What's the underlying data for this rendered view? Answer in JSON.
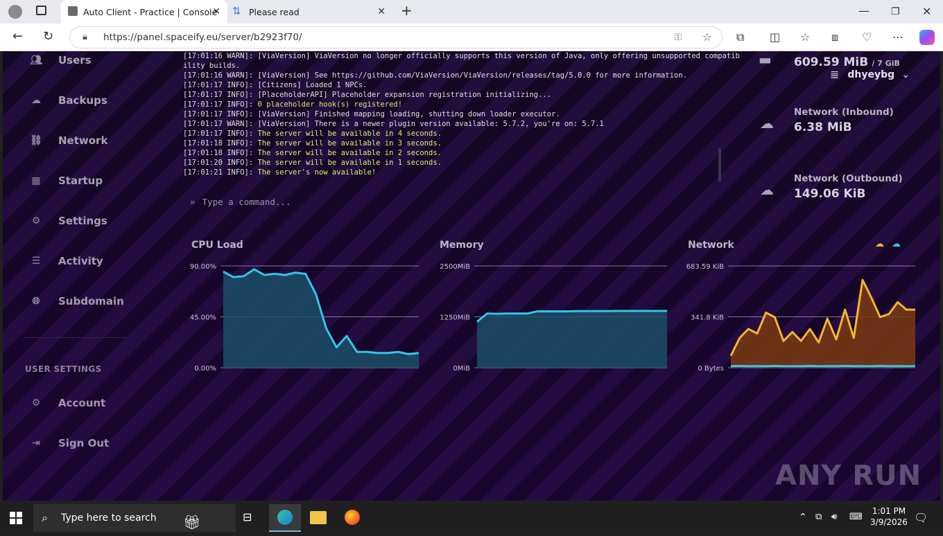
{
  "browser": {
    "tabs": [
      {
        "label": "Auto Client - Practice | Console"
      },
      {
        "label": "Please read"
      }
    ],
    "url": "https://panel.spaceify.eu/server/b2923f70/"
  },
  "sidebar": {
    "items": [
      {
        "label": "Users",
        "icon": "users-icon"
      },
      {
        "label": "Backups",
        "icon": "cloud-icon"
      },
      {
        "label": "Network",
        "icon": "network-icon"
      },
      {
        "label": "Startup",
        "icon": "chart-icon"
      },
      {
        "label": "Settings",
        "icon": "gear-icon"
      },
      {
        "label": "Activity",
        "icon": "list-icon"
      },
      {
        "label": "Subdomain",
        "icon": "globe-icon"
      }
    ],
    "section_title": "USER SETTINGS",
    "user_items": [
      {
        "label": "Account",
        "icon": "gear-icon"
      },
      {
        "label": "Sign Out",
        "icon": "signout-icon"
      }
    ]
  },
  "console": {
    "lines": [
      {
        "text": "[17:01:16 WARN]: [ViaVersion] ViaVersion no longer officially supports this version of Java, only offering unsupported compatib",
        "cls": "warn"
      },
      {
        "text": "ility builds.",
        "cls": "warn"
      },
      {
        "text": "[17:01:16 WARN]: [ViaVersion] See https://github.com/ViaVersion/ViaVersion/releases/tag/5.0.0 for more information.",
        "cls": "warn"
      },
      {
        "text": "[17:01:17 INFO]: [Citizens] Loaded 1 NPCs.",
        "cls": "warn"
      },
      {
        "text": "[17:01:17 INFO]: [PlaceholderAPI] Placeholder expansion registration initializing...",
        "cls": "warn"
      },
      {
        "text": "[17:01:17 INFO]: ",
        "extra": "0 placeholder hook(s) registered!",
        "cls": "ylw"
      },
      {
        "text": "[17:01:17 INFO]: [ViaVersion] Finished mapping loading, shutting down loader executor.",
        "cls": "warn"
      },
      {
        "text": "[17:01:17 WARN]: [ViaVersion] There is a newer plugin version available: 5.7.2, you're on: 5.7.1",
        "cls": "warn"
      },
      {
        "text": "[17:01:17 INFO]: ",
        "extra": "The server will be available in 4 seconds.",
        "cls": "grn"
      },
      {
        "text": "[17:01:18 INFO]: ",
        "extra": "The server will be available in 3 seconds.",
        "cls": "grn"
      },
      {
        "text": "[17:01:18 INFO]: ",
        "extra": "The server will be available in 2 seconds.",
        "cls": "grn"
      },
      {
        "text": "[17:01:20 INFO]: ",
        "extra": "The server will be available in 1 seconds.",
        "cls": "grn"
      },
      {
        "text": "[17:01:21 INFO]: ",
        "extra": "The server's now available!",
        "cls": "grn"
      }
    ],
    "command_placeholder": "Type a command..."
  },
  "header": {
    "username": "dhyeybg"
  },
  "stats": {
    "memory_value": "609.59 MiB",
    "memory_limit": "/ 7 GiB",
    "inbound_label": "Network (Inbound)",
    "inbound_value": "6.38 MiB",
    "outbound_label": "Network (Outbound)",
    "outbound_value": "149.06 KiB"
  },
  "chart_data": [
    {
      "type": "area",
      "title": "CPU Load",
      "ytick_labels": [
        "90.00%",
        "45.00%",
        "0.00%"
      ],
      "ylim": [
        0,
        90
      ],
      "series": [
        {
          "values": [
            85,
            80,
            81,
            87,
            82,
            83,
            82,
            84,
            83,
            65,
            35,
            18,
            28,
            14,
            14,
            13,
            13,
            14,
            12,
            13
          ]
        }
      ],
      "colors": {
        "line": "#33c6e8",
        "fill": "#1b4f66"
      }
    },
    {
      "type": "area",
      "title": "Memory",
      "ytick_labels": [
        "2500MiB",
        "1250MiB",
        "0MiB"
      ],
      "ylim": [
        0,
        2500
      ],
      "series": [
        {
          "values": [
            1130,
            1330,
            1325,
            1330,
            1330,
            1330,
            1385,
            1385,
            1385,
            1385,
            1390,
            1390,
            1390,
            1390,
            1395,
            1395,
            1395,
            1395,
            1395,
            1395
          ]
        }
      ],
      "colors": {
        "line": "#33c6e8",
        "fill": "#1b4f66"
      }
    },
    {
      "type": "area",
      "title": "Network",
      "ytick_labels": [
        "683.59 KiB",
        "341.8 KiB",
        "0 Bytes"
      ],
      "ylim": [
        0,
        683.59
      ],
      "series": [
        {
          "values": [
            80,
            200,
            260,
            230,
            370,
            340,
            180,
            240,
            180,
            260,
            170,
            330,
            190,
            390,
            200,
            590,
            470,
            340,
            360,
            440,
            390,
            390
          ],
          "color": "#f5b52e",
          "fill": "#7a3b12"
        },
        {
          "values": [
            10,
            12,
            10,
            11,
            10,
            12,
            10,
            11,
            10,
            12,
            10,
            11,
            10,
            12,
            10,
            11,
            10,
            12,
            10,
            11,
            10,
            11
          ],
          "color": "#33c6e8",
          "fill": "none"
        }
      ]
    }
  ],
  "watermark": "ANY RUN",
  "taskbar": {
    "search_placeholder": "Type here to search",
    "time": "1:01 PM",
    "date": "3/9/2026"
  }
}
